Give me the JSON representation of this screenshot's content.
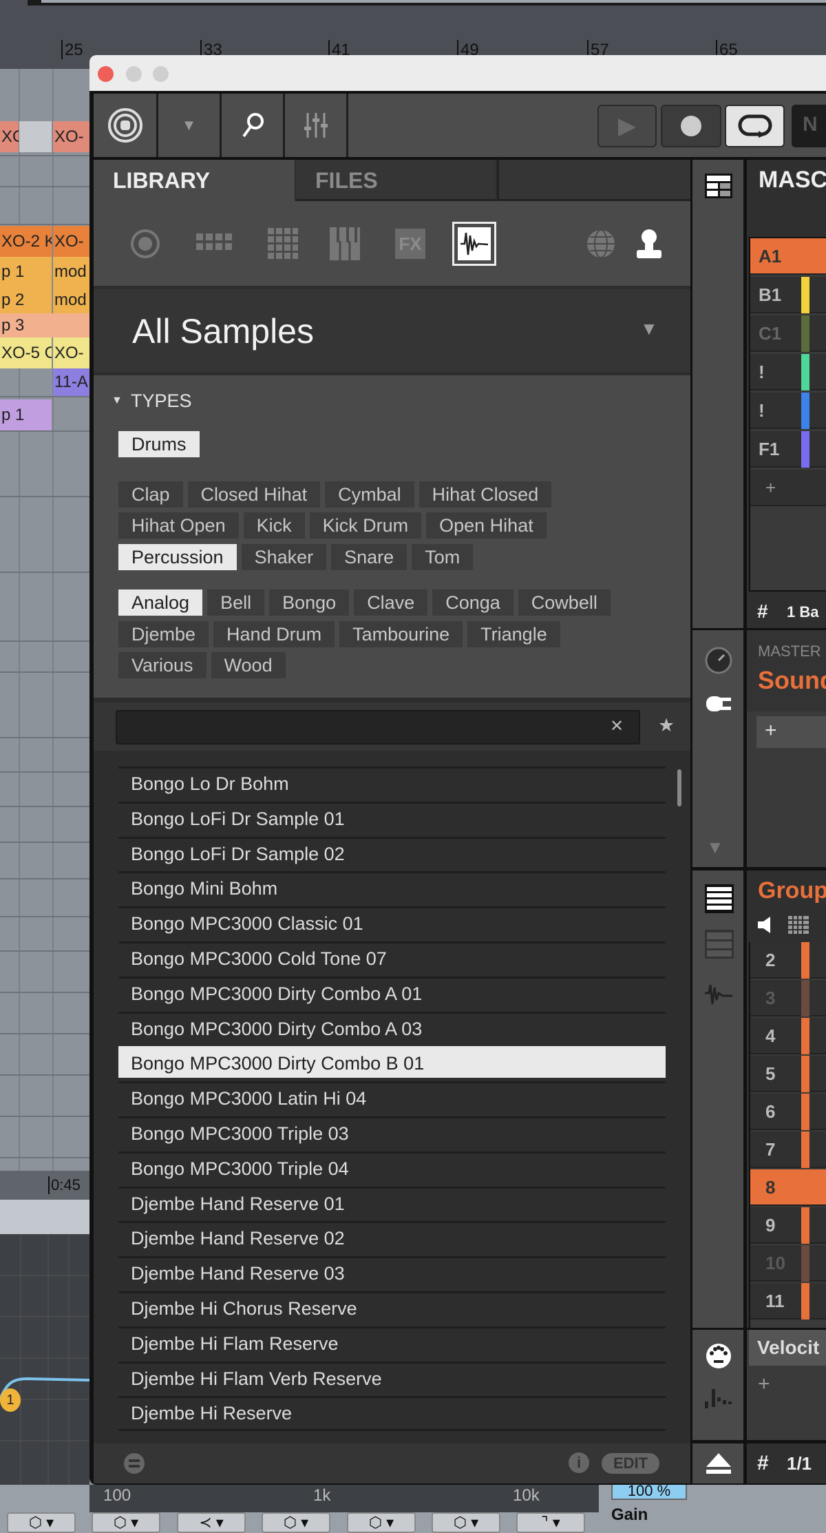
{
  "daw": {
    "ruler": [
      "25",
      "33",
      "41",
      "49",
      "57",
      "65"
    ],
    "clips": [
      {
        "label": "XO",
        "color": "#e08a7a"
      },
      {
        "label": "",
        "color": "#c6c9cd"
      },
      {
        "label": "XO-",
        "color": "#e08a7a"
      },
      {
        "label": "XO-2 K",
        "color": "#e8813a"
      },
      {
        "label": "XO-",
        "color": "#e8813a"
      },
      {
        "label": "p 1",
        "color": "#efb24f"
      },
      {
        "label": "mod",
        "color": "#efb24f"
      },
      {
        "label": "p 2",
        "color": "#efb24f"
      },
      {
        "label": "mod",
        "color": "#efb24f"
      },
      {
        "label": "p 3",
        "color": "#f3b08e"
      },
      {
        "label": "XO-5 C",
        "color": "#f0e58a"
      },
      {
        "label": "XO-",
        "color": "#f0e58a"
      },
      {
        "label": "11-A",
        "color": "#8d7fe0"
      },
      {
        "label": "p 1",
        "color": "#c09ee0"
      }
    ],
    "time": "0:45",
    "eq_band": "1",
    "eq_labels": [
      "100",
      "1k",
      "10k"
    ],
    "percent": "100 %",
    "gain": "Gain"
  },
  "window": {
    "tabs": [
      {
        "label": "LIBRARY",
        "active": true
      },
      {
        "label": "FILES",
        "active": false
      }
    ],
    "icons": [
      "instrument-icon",
      "group-icon",
      "sound-icon",
      "piano-icon",
      "fx-icon",
      "sample-icon",
      "globe-icon",
      "user-icon"
    ],
    "selected_icon": "sample-icon",
    "browser_title": "All Samples",
    "types_label": "TYPES",
    "tag_rows": [
      [
        {
          "label": "Drums",
          "sel": true
        }
      ],
      [
        {
          "label": "Clap"
        },
        {
          "label": "Closed Hihat"
        },
        {
          "label": "Cymbal"
        },
        {
          "label": "Hihat Closed"
        }
      ],
      [
        {
          "label": "Hihat Open"
        },
        {
          "label": "Kick"
        },
        {
          "label": "Kick Drum"
        },
        {
          "label": "Open Hihat"
        }
      ],
      [
        {
          "label": "Percussion",
          "sel": true
        },
        {
          "label": "Shaker"
        },
        {
          "label": "Snare"
        },
        {
          "label": "Tom"
        }
      ],
      [
        {
          "label": "Analog",
          "sel": true
        },
        {
          "label": "Bell"
        },
        {
          "label": "Bongo"
        },
        {
          "label": "Clave"
        },
        {
          "label": "Conga"
        },
        {
          "label": "Cowbell"
        }
      ],
      [
        {
          "label": "Djembe"
        },
        {
          "label": "Hand Drum"
        },
        {
          "label": "Tambourine"
        },
        {
          "label": "Triangle"
        }
      ],
      [
        {
          "label": "Various"
        },
        {
          "label": "Wood"
        }
      ]
    ],
    "search": {
      "value": "",
      "clear": "✕",
      "star": "★"
    },
    "results": [
      "Bongo Lo Dr Bohm",
      "Bongo LoFi Dr Sample 01",
      "Bongo LoFi Dr Sample 02",
      "Bongo Mini Bohm",
      "Bongo MPC3000 Classic 01",
      "Bongo MPC3000 Cold Tone 07",
      "Bongo MPC3000 Dirty Combo A 01",
      "Bongo MPC3000 Dirty Combo A 03",
      "Bongo MPC3000 Dirty Combo B 01",
      "Bongo MPC3000 Latin Hi 04",
      "Bongo MPC3000 Triple 03",
      "Bongo MPC3000 Triple 04",
      "Djembe Hand Reserve 01",
      "Djembe Hand Reserve 02",
      "Djembe Hand Reserve 03",
      "Djembe Hi Chorus Reserve",
      "Djembe Hi Flam Reserve",
      "Djembe Hi Flam Verb Reserve",
      "Djembe Hi Reserve"
    ],
    "selected_result": "Bongo MPC3000 Dirty Combo B 01",
    "footer": {
      "info": "i",
      "edit": "EDIT"
    },
    "right": {
      "project_title": "MASC",
      "scenes": [
        {
          "label": "A1",
          "color": "#e8703a",
          "active": true
        },
        {
          "label": "B1",
          "color": "#f2d13c"
        },
        {
          "label": "C1",
          "color": "#5a6b3c",
          "dim": true
        },
        {
          "label": "!",
          "color": "#4fd79a"
        },
        {
          "label": "!",
          "color": "#3d82e8"
        },
        {
          "label": "F1",
          "color": "#7a6cf0"
        },
        {
          "label": "+",
          "color": ""
        }
      ],
      "scene_footer": "1 Ba",
      "master_label": "MASTER",
      "sound_label": "Sound",
      "add": "+",
      "group_label": "Group",
      "pads": [
        {
          "n": "2"
        },
        {
          "n": "3",
          "dim": true
        },
        {
          "n": "4"
        },
        {
          "n": "5"
        },
        {
          "n": "6"
        },
        {
          "n": "7"
        },
        {
          "n": "8",
          "active": true
        },
        {
          "n": "9"
        },
        {
          "n": "10",
          "dim": true
        },
        {
          "n": "11"
        }
      ],
      "accent": "#e8703a",
      "velocity_label": "Velocit",
      "page": "1/1"
    }
  }
}
